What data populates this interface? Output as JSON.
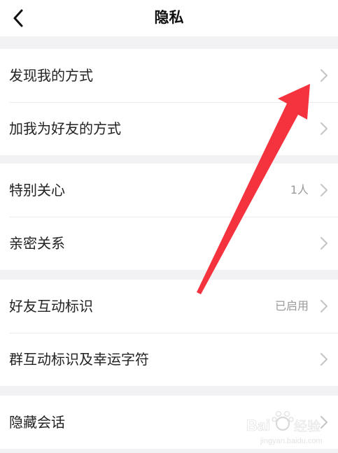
{
  "nav": {
    "title": "隐私",
    "back_icon": "chevron-left-icon"
  },
  "groups": [
    {
      "rows": [
        {
          "label": "发现我的方式",
          "value": ""
        },
        {
          "label": "加我为好友的方式",
          "value": ""
        }
      ]
    },
    {
      "rows": [
        {
          "label": "特别关心",
          "value": "1人"
        },
        {
          "label": "亲密关系",
          "value": ""
        }
      ]
    },
    {
      "rows": [
        {
          "label": "好友互动标识",
          "value": "已启用"
        },
        {
          "label": "群互动标识及幸运字符",
          "value": ""
        }
      ]
    },
    {
      "rows": [
        {
          "label": "隐藏会话",
          "value": ""
        }
      ]
    }
  ],
  "annotation": {
    "type": "red-arrow",
    "color": "#f5333f",
    "points_to": "发现我的方式"
  },
  "watermark": {
    "brand": "Baidu 经验",
    "url": "jingyan.baidu.com"
  },
  "colors": {
    "background": "#f2f2f4",
    "row_background": "#ffffff",
    "label": "#222222",
    "value": "#9a9a9a",
    "chevron": "#c4c4c4"
  }
}
